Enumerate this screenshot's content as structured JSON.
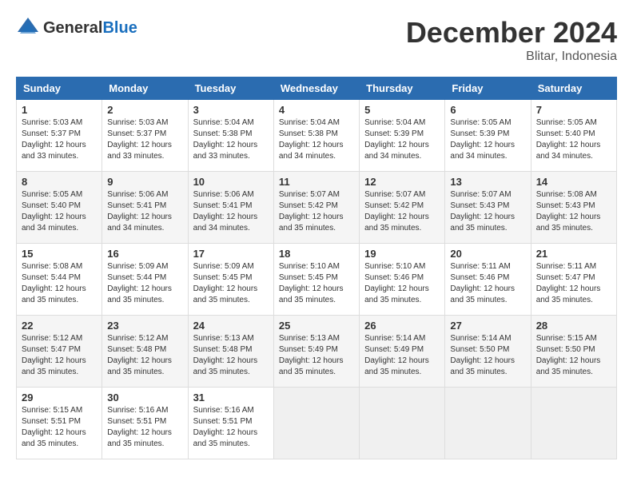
{
  "header": {
    "logo_general": "General",
    "logo_blue": "Blue",
    "month_title": "December 2024",
    "location": "Blitar, Indonesia"
  },
  "weekdays": [
    "Sunday",
    "Monday",
    "Tuesday",
    "Wednesday",
    "Thursday",
    "Friday",
    "Saturday"
  ],
  "weeks": [
    [
      {
        "day": "1",
        "sunrise": "5:03 AM",
        "sunset": "5:37 PM",
        "daylight": "12 hours and 33 minutes."
      },
      {
        "day": "2",
        "sunrise": "5:03 AM",
        "sunset": "5:37 PM",
        "daylight": "12 hours and 33 minutes."
      },
      {
        "day": "3",
        "sunrise": "5:04 AM",
        "sunset": "5:38 PM",
        "daylight": "12 hours and 33 minutes."
      },
      {
        "day": "4",
        "sunrise": "5:04 AM",
        "sunset": "5:38 PM",
        "daylight": "12 hours and 34 minutes."
      },
      {
        "day": "5",
        "sunrise": "5:04 AM",
        "sunset": "5:39 PM",
        "daylight": "12 hours and 34 minutes."
      },
      {
        "day": "6",
        "sunrise": "5:05 AM",
        "sunset": "5:39 PM",
        "daylight": "12 hours and 34 minutes."
      },
      {
        "day": "7",
        "sunrise": "5:05 AM",
        "sunset": "5:40 PM",
        "daylight": "12 hours and 34 minutes."
      }
    ],
    [
      {
        "day": "8",
        "sunrise": "5:05 AM",
        "sunset": "5:40 PM",
        "daylight": "12 hours and 34 minutes."
      },
      {
        "day": "9",
        "sunrise": "5:06 AM",
        "sunset": "5:41 PM",
        "daylight": "12 hours and 34 minutes."
      },
      {
        "day": "10",
        "sunrise": "5:06 AM",
        "sunset": "5:41 PM",
        "daylight": "12 hours and 34 minutes."
      },
      {
        "day": "11",
        "sunrise": "5:07 AM",
        "sunset": "5:42 PM",
        "daylight": "12 hours and 35 minutes."
      },
      {
        "day": "12",
        "sunrise": "5:07 AM",
        "sunset": "5:42 PM",
        "daylight": "12 hours and 35 minutes."
      },
      {
        "day": "13",
        "sunrise": "5:07 AM",
        "sunset": "5:43 PM",
        "daylight": "12 hours and 35 minutes."
      },
      {
        "day": "14",
        "sunrise": "5:08 AM",
        "sunset": "5:43 PM",
        "daylight": "12 hours and 35 minutes."
      }
    ],
    [
      {
        "day": "15",
        "sunrise": "5:08 AM",
        "sunset": "5:44 PM",
        "daylight": "12 hours and 35 minutes."
      },
      {
        "day": "16",
        "sunrise": "5:09 AM",
        "sunset": "5:44 PM",
        "daylight": "12 hours and 35 minutes."
      },
      {
        "day": "17",
        "sunrise": "5:09 AM",
        "sunset": "5:45 PM",
        "daylight": "12 hours and 35 minutes."
      },
      {
        "day": "18",
        "sunrise": "5:10 AM",
        "sunset": "5:45 PM",
        "daylight": "12 hours and 35 minutes."
      },
      {
        "day": "19",
        "sunrise": "5:10 AM",
        "sunset": "5:46 PM",
        "daylight": "12 hours and 35 minutes."
      },
      {
        "day": "20",
        "sunrise": "5:11 AM",
        "sunset": "5:46 PM",
        "daylight": "12 hours and 35 minutes."
      },
      {
        "day": "21",
        "sunrise": "5:11 AM",
        "sunset": "5:47 PM",
        "daylight": "12 hours and 35 minutes."
      }
    ],
    [
      {
        "day": "22",
        "sunrise": "5:12 AM",
        "sunset": "5:47 PM",
        "daylight": "12 hours and 35 minutes."
      },
      {
        "day": "23",
        "sunrise": "5:12 AM",
        "sunset": "5:48 PM",
        "daylight": "12 hours and 35 minutes."
      },
      {
        "day": "24",
        "sunrise": "5:13 AM",
        "sunset": "5:48 PM",
        "daylight": "12 hours and 35 minutes."
      },
      {
        "day": "25",
        "sunrise": "5:13 AM",
        "sunset": "5:49 PM",
        "daylight": "12 hours and 35 minutes."
      },
      {
        "day": "26",
        "sunrise": "5:14 AM",
        "sunset": "5:49 PM",
        "daylight": "12 hours and 35 minutes."
      },
      {
        "day": "27",
        "sunrise": "5:14 AM",
        "sunset": "5:50 PM",
        "daylight": "12 hours and 35 minutes."
      },
      {
        "day": "28",
        "sunrise": "5:15 AM",
        "sunset": "5:50 PM",
        "daylight": "12 hours and 35 minutes."
      }
    ],
    [
      {
        "day": "29",
        "sunrise": "5:15 AM",
        "sunset": "5:51 PM",
        "daylight": "12 hours and 35 minutes."
      },
      {
        "day": "30",
        "sunrise": "5:16 AM",
        "sunset": "5:51 PM",
        "daylight": "12 hours and 35 minutes."
      },
      {
        "day": "31",
        "sunrise": "5:16 AM",
        "sunset": "5:51 PM",
        "daylight": "12 hours and 35 minutes."
      },
      null,
      null,
      null,
      null
    ]
  ],
  "labels": {
    "sunrise_prefix": "Sunrise: ",
    "sunset_prefix": "Sunset: ",
    "daylight_prefix": "Daylight: "
  }
}
